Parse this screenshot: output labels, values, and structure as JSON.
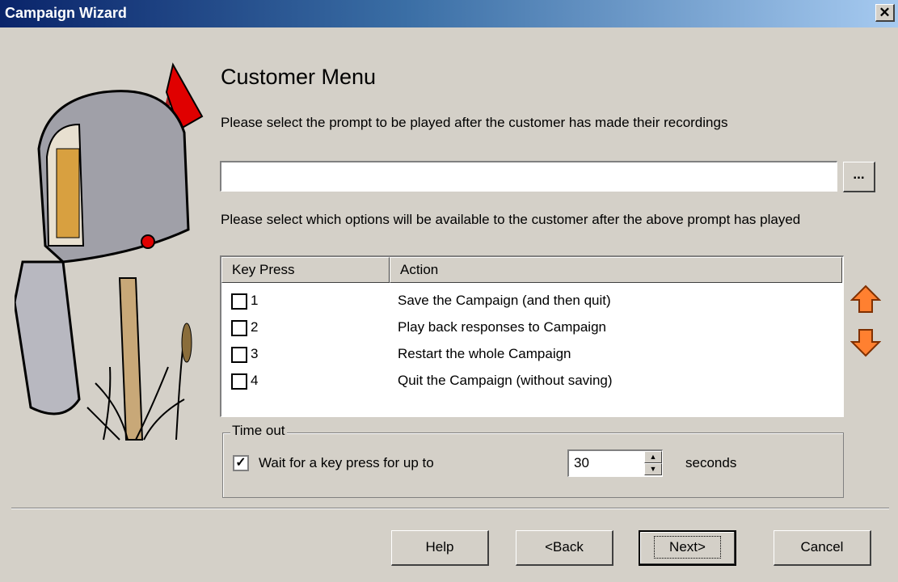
{
  "window": {
    "title": "Campaign Wizard",
    "close_label": "✕"
  },
  "page": {
    "heading": "Customer Menu",
    "prompt_description": "Please select the prompt to be played after the customer has made their recordings",
    "prompt_value": "",
    "browse_label": "...",
    "options_description": "Please select which options will be available to the customer after the above prompt has played"
  },
  "table": {
    "columns": [
      "Key Press",
      "Action"
    ],
    "rows": [
      {
        "key": "1",
        "action": "Save the Campaign (and then quit)",
        "checked": false
      },
      {
        "key": "2",
        "action": "Play back responses to Campaign",
        "checked": false
      },
      {
        "key": "3",
        "action": "Restart the whole Campaign",
        "checked": false
      },
      {
        "key": "4",
        "action": "Quit the Campaign (without saving)",
        "checked": false
      }
    ]
  },
  "timeout": {
    "group_label": "Time out",
    "checkbox_checked": true,
    "checkbox_mark": "✓",
    "wait_label": "Wait for a key press for up to",
    "seconds_value": "30",
    "seconds_label": "seconds"
  },
  "buttons": {
    "help": "Help",
    "back": "<Back",
    "next": "Next>",
    "cancel": "Cancel"
  },
  "colors": {
    "accent_orange": "#ff8030",
    "flag_red": "#e00000"
  }
}
